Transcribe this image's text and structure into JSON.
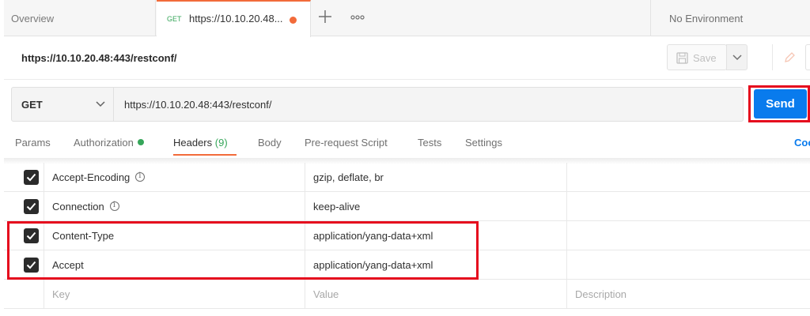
{
  "tabs": {
    "overview_label": "Overview",
    "active": {
      "method": "GET",
      "title": "https://10.10.20.48..."
    },
    "environment": "No Environment"
  },
  "request": {
    "title": "https://10.10.20.48:443/restconf/",
    "save_label": "Save",
    "method": "GET",
    "url": "https://10.10.20.48:443/restconf/",
    "send_label": "Send"
  },
  "subtabs": {
    "params": "Params",
    "authorization": "Authorization",
    "headers": "Headers",
    "headers_count": "(9)",
    "body": "Body",
    "prerequest": "Pre-request Script",
    "tests": "Tests",
    "settings": "Settings",
    "cookies": "Coo"
  },
  "headers": [
    {
      "key": "Accept-Encoding",
      "value": "gzip, deflate, br",
      "checked": true,
      "info": true
    },
    {
      "key": "Connection",
      "value": "keep-alive",
      "checked": true,
      "info": true
    },
    {
      "key": "Content-Type",
      "value": "application/yang-data+xml",
      "checked": true,
      "info": false
    },
    {
      "key": "Accept",
      "value": "application/yang-data+xml",
      "checked": true,
      "info": false
    }
  ],
  "placeholders": {
    "key": "Key",
    "value": "Value",
    "description": "Description"
  },
  "colors": {
    "accent": "#f26b3a",
    "send": "#097bed",
    "highlight": "#e5091d",
    "success": "#36a65a"
  }
}
